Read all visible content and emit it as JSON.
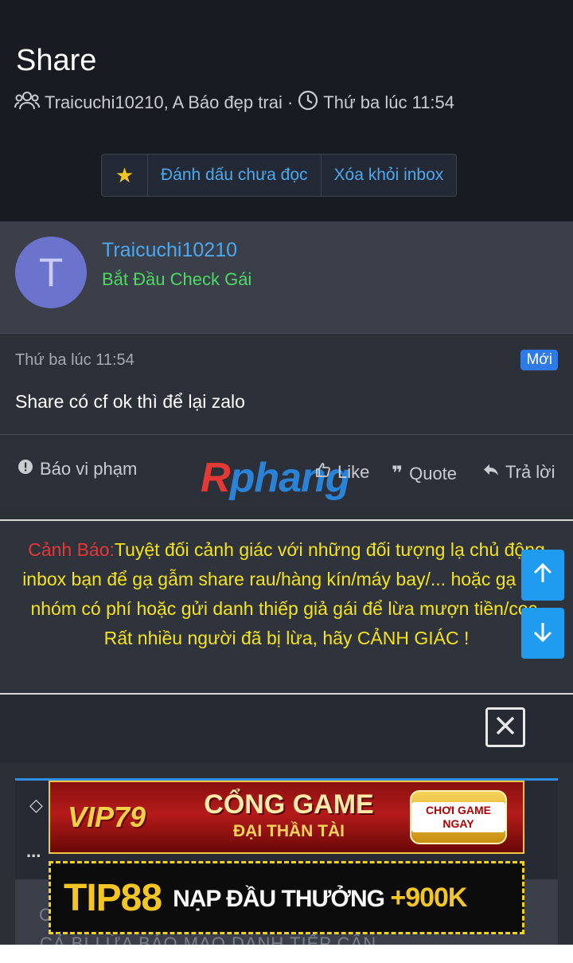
{
  "header": {
    "title": "Share",
    "participants": "Traicuchi10210, A Báo đẹp trai ·",
    "time": "Thứ ba lúc 11:54"
  },
  "toolbar": {
    "star": "★",
    "mark_unread": "Đánh dấu chưa đọc",
    "remove_inbox": "Xóa khỏi inbox"
  },
  "author": {
    "avatar_letter": "T",
    "username": "Traicuchi10210",
    "user_title": "Bắt Đầu Check Gái"
  },
  "message": {
    "time": "Thứ ba lúc 11:54",
    "badge": "Mới",
    "body": "Share có cf ok thì để lại zalo"
  },
  "actions": {
    "report": "Báo vi phạm",
    "like": "Like",
    "quote": "Quote",
    "reply": "Trả lời"
  },
  "logo": {
    "r": "R",
    "rest": "phang"
  },
  "warning": {
    "label": "Cảnh Báo:",
    "text": "Tuyệt đối cảnh giác với những đối tượng lạ chủ động inbox bạn để gạ gẫm share rau/hàng kín/máy bay/... hoặc gạ vào nhóm có phí hoặc gửi danh thiếp giả gái để lừa mượn tiền/cọc.",
    "line2": "Rất nhiều người đã bị lừa, hãy CẢNH GIÁC !"
  },
  "ads": {
    "banner1_vip": "VIP79",
    "banner1_title": "CỔNG GAME",
    "banner1_sub": "ĐẠI THẦN TÀI",
    "banner1_cta": "CHƠI GAME NGAY",
    "banner2_brand": "TIP88",
    "banner2_text": "NẠP ĐẦU THƯỞNG",
    "banner2_amount": "+900K"
  },
  "editor": {
    "more": "...",
    "faded_text": "CẢ BỊ LỪA BÁO MẠO DANH TIẾP CẬN"
  },
  "colors": {
    "accent": "#4ea8ef",
    "user_title": "#4cd964",
    "badge": "#2f7ae5",
    "warning_text": "#f5e31a",
    "warning_label": "#e53935",
    "scroll_button": "#1f9cf0"
  }
}
